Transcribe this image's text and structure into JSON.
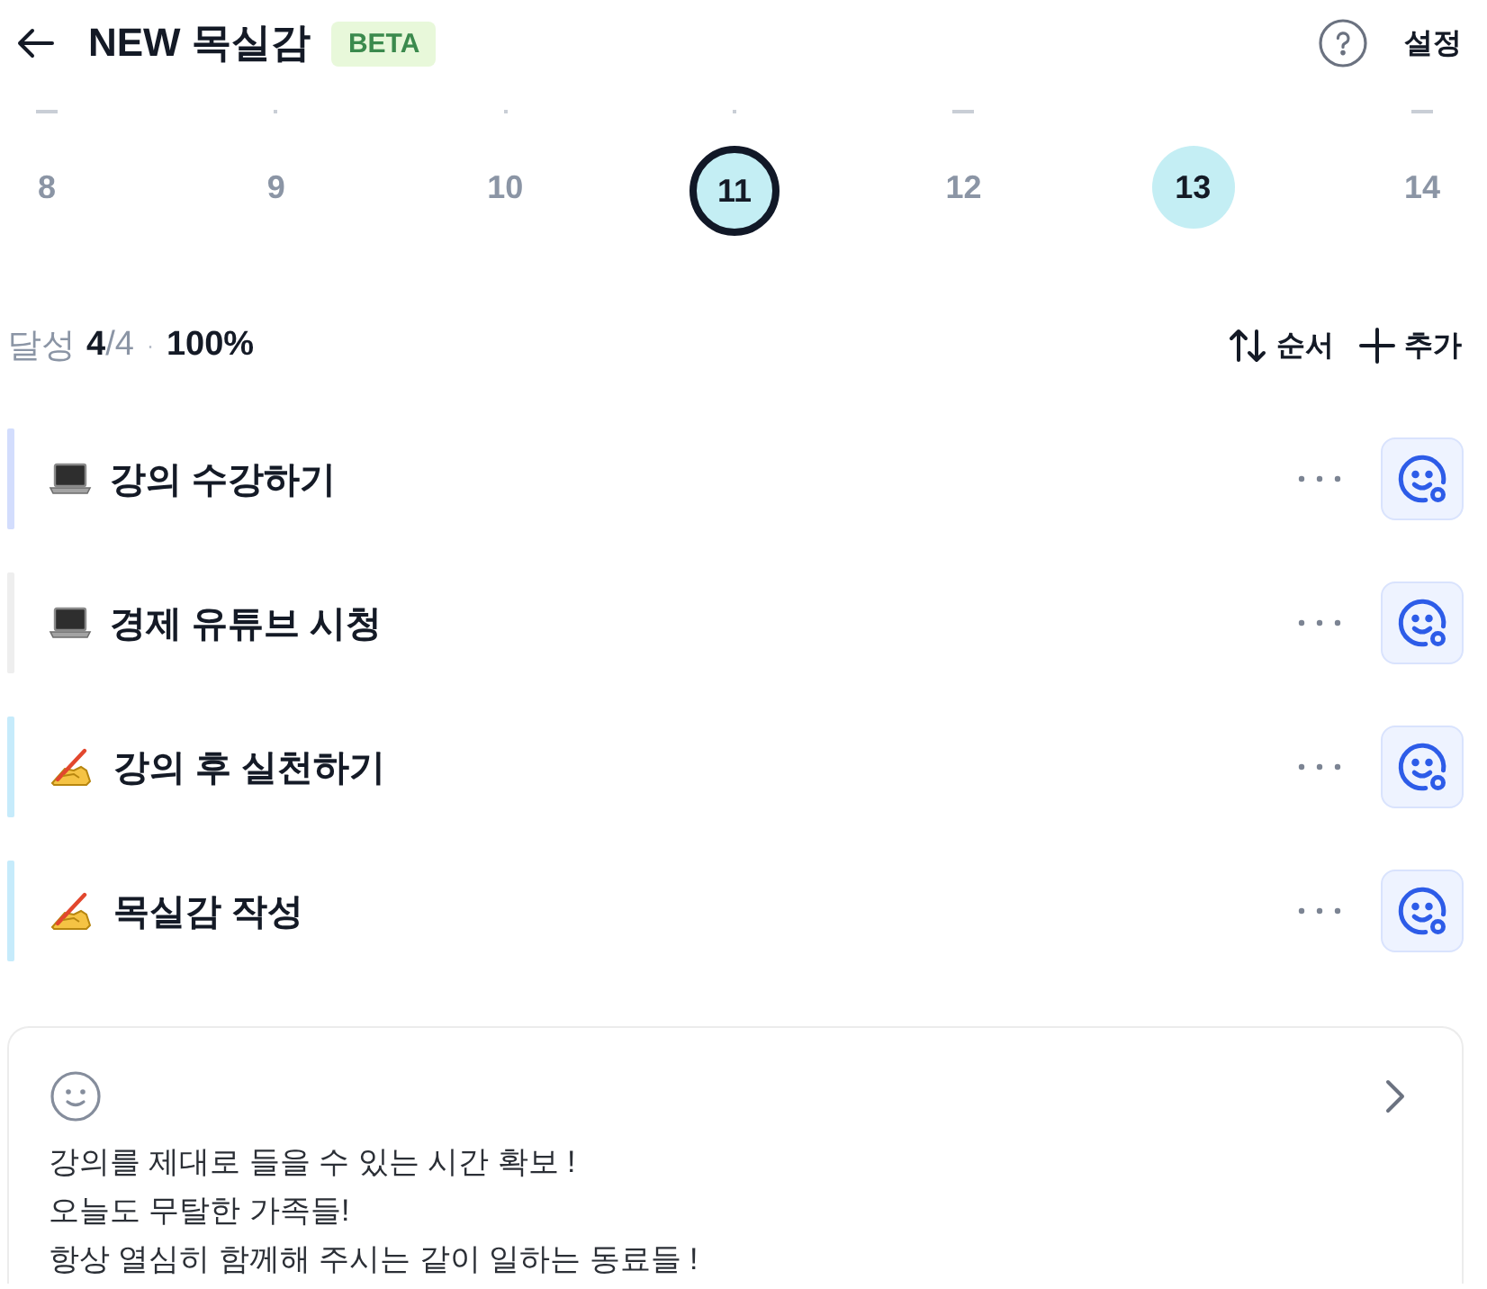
{
  "header": {
    "title": "NEW 목실감",
    "badge": "BETA",
    "settings": "설정"
  },
  "days": [
    {
      "kind": "dash",
      "label": "8",
      "selected": false,
      "filled": false
    },
    {
      "kind": "dot",
      "label": "9",
      "selected": false,
      "filled": false
    },
    {
      "kind": "dot",
      "label": "10",
      "selected": false,
      "filled": false
    },
    {
      "kind": "dot",
      "label": "11",
      "selected": true,
      "filled": true
    },
    {
      "kind": "dash",
      "label": "12",
      "selected": false,
      "filled": false
    },
    {
      "kind": "plain",
      "label": "13",
      "selected": false,
      "filled": true
    },
    {
      "kind": "dash",
      "label": "14",
      "selected": false,
      "filled": false
    }
  ],
  "summary": {
    "label": "달성",
    "done": "4",
    "total": "/4",
    "separator": "·",
    "percent": "100%"
  },
  "actions": [
    {
      "kind": "sort",
      "label": "순서"
    },
    {
      "kind": "add",
      "label": "추가"
    }
  ],
  "tasks": [
    {
      "kind": "laptop",
      "title": "강의 수강하기",
      "color": "#d3ddfd"
    },
    {
      "kind": "laptop",
      "title": "경제 유튜브 시청",
      "color": "#eeeeee"
    },
    {
      "kind": "writing",
      "title": "강의 후 실천하기",
      "color": "#c6ebfb"
    },
    {
      "kind": "writing",
      "title": "목실감 작성",
      "color": "#c6ebfb"
    }
  ],
  "memo": {
    "lines": [
      "강의를 제대로 들을 수 있는 시간 확보 !",
      "오늘도 무탈한 가족들!",
      "항상 열심히 함께해 주시는 같이 일하는 동료들 !"
    ]
  }
}
